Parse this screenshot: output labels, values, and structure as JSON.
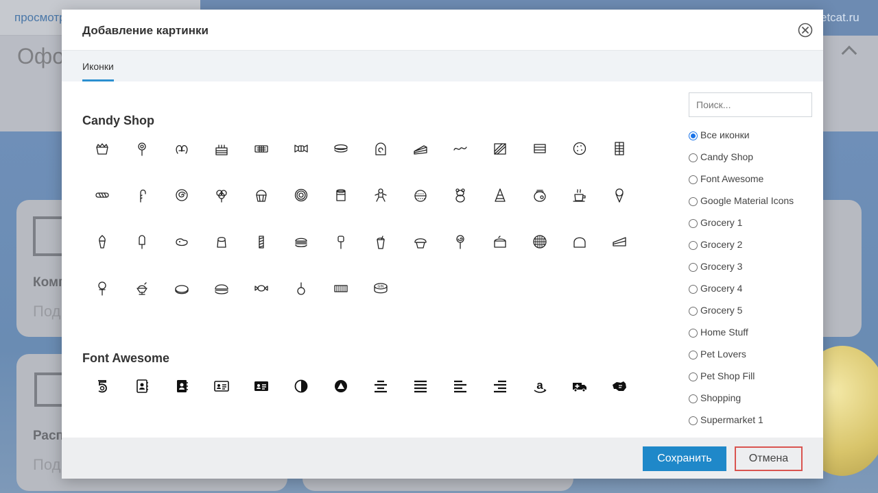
{
  "background": {
    "top_link_left": "просмотр",
    "top_link_right": "etcat.ru",
    "heading": "Оформление",
    "card1_label": "Комп",
    "card1_sub": "Под",
    "card2_label": "Расп",
    "card2_sub": "Под"
  },
  "modal": {
    "title": "Добавление картинки",
    "tab_label": "Иконки",
    "sections": [
      {
        "title": "Candy Shop",
        "icons": [
          "birthday-cake-slice-icon",
          "lollipop-icon",
          "pretzel-icon",
          "layered-cake-icon",
          "chocolate-bar-icon",
          "wrapped-candy-icon",
          "macaron-icon",
          "swiss-roll-icon",
          "cake-slice-icon",
          "gummy-worm-icon",
          "chocolate-slab-icon",
          "sandwich-cookie-icon",
          "cookie-icon",
          "chocolate-tablet-icon",
          "candy-stick-icon",
          "candy-cane-icon",
          "cinnamon-bun-icon",
          "cotton-candy-icon",
          "cupcake-icon",
          "donut-icon",
          "candy-jar-icon",
          "gingerbread-man-icon",
          "cherry-pie-icon",
          "gummy-bear-icon",
          "candy-cone-icon",
          "honey-pot-icon",
          "hot-chocolate-icon",
          "ice-cream-cone-icon",
          "soft-serve-icon",
          "popsicle-icon",
          "jelly-bean-icon",
          "pudding-icon",
          "rock-candy-icon",
          "burger-macaron-icon",
          "marshmallow-stick-icon",
          "milkshake-icon",
          "muffin-icon",
          "swirl-lollipop-icon",
          "cheesecake-icon",
          "waffle-icon",
          "gumdrop-icon",
          "pie-slice-icon",
          "cake-pop-icon",
          "sundae-icon",
          "tart-icon",
          "whoopie-pie-icon",
          "bonbon-icon",
          "candy-apple-icon",
          "wafer-icon",
          "gin-tin-icon"
        ]
      },
      {
        "title": "Font Awesome",
        "icons": [
          "500px-icon",
          "address-book-icon",
          "address-book-solid-icon",
          "address-card-icon",
          "address-card-solid-icon",
          "adjust-icon",
          "adversal-icon",
          "align-center-icon",
          "align-justify-icon",
          "align-left-icon",
          "align-right-icon",
          "amazon-icon",
          "ambulance-icon",
          "american-sign-language-icon"
        ]
      }
    ],
    "search_placeholder": "Поиск...",
    "categories": [
      {
        "label": "Все иконки",
        "checked": true
      },
      {
        "label": "Candy Shop",
        "checked": false
      },
      {
        "label": "Font Awesome",
        "checked": false
      },
      {
        "label": "Google Material Icons",
        "checked": false
      },
      {
        "label": "Grocery 1",
        "checked": false
      },
      {
        "label": "Grocery 2",
        "checked": false
      },
      {
        "label": "Grocery 3",
        "checked": false
      },
      {
        "label": "Grocery 4",
        "checked": false
      },
      {
        "label": "Grocery 5",
        "checked": false
      },
      {
        "label": "Home Stuff",
        "checked": false
      },
      {
        "label": "Pet Lovers",
        "checked": false
      },
      {
        "label": "Pet Shop Fill",
        "checked": false
      },
      {
        "label": "Shopping",
        "checked": false
      },
      {
        "label": "Supermarket 1",
        "checked": false
      }
    ],
    "save_label": "Сохранить",
    "cancel_label": "Отмена"
  },
  "colors": {
    "primary": "#1f88c9",
    "cancel_border": "#d9534f",
    "tab_underline": "#2b8fd0",
    "radio_checked": "#1a73e8"
  }
}
